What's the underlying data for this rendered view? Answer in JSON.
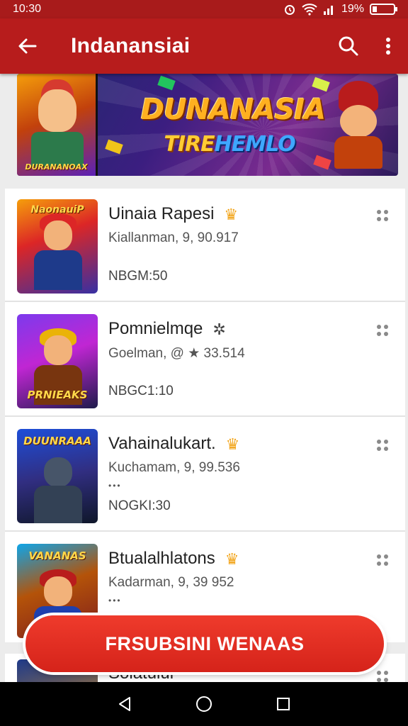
{
  "status_bar": {
    "time": "10:30",
    "battery": "19%",
    "icons": [
      "alarm-icon",
      "wifi-icon",
      "signal-icon",
      "battery-icon"
    ]
  },
  "app_bar": {
    "title": "Indanansiai",
    "icons": [
      "back-arrow-icon",
      "search-icon",
      "more-vertical-icon"
    ]
  },
  "banner": {
    "headline": "DUNANASIA",
    "subline_a": "TIRE",
    "subline_b": "HEMLO",
    "poster_caption": "DURANANOAX"
  },
  "games": [
    {
      "title": "Uinaia Rapesi",
      "badge_icon": "crown-icon",
      "subtitle": "Kiallanman, 9, 90.917",
      "extra": "",
      "code": "NBGM:50",
      "thumb_caption": "NaonauiP"
    },
    {
      "title": "Pomnielmqe",
      "badge_icon": "sparkle-icon",
      "subtitle": "Goelman, @ ★ 33.514",
      "extra": "",
      "code": "NBGC1:10",
      "thumb_caption": "PRNIEAKS"
    },
    {
      "title": "Vahainalukart.",
      "badge_icon": "crown-icon",
      "subtitle": "Kuchamam, 9, 99.536",
      "extra": "•••",
      "code": "NOGKI:30",
      "thumb_caption": "DUUNRAAA"
    },
    {
      "title": "Btualalhlatons",
      "badge_icon": "crown-icon",
      "subtitle": "Kadarman, 9, 39 952",
      "extra": "•••",
      "code": "",
      "thumb_caption": "VANANAS"
    }
  ],
  "peek_item": {
    "title": "Soiatulul"
  },
  "cta": {
    "label": "FRSUBSINI WENAAS"
  },
  "nav_bar": {
    "icons": [
      "back-triangle-icon",
      "home-circle-icon",
      "recents-square-icon"
    ]
  },
  "colors": {
    "primary": "#b71c1c",
    "status": "#a81b1b",
    "cta": "#e53124",
    "badge": "#f2a51b"
  }
}
